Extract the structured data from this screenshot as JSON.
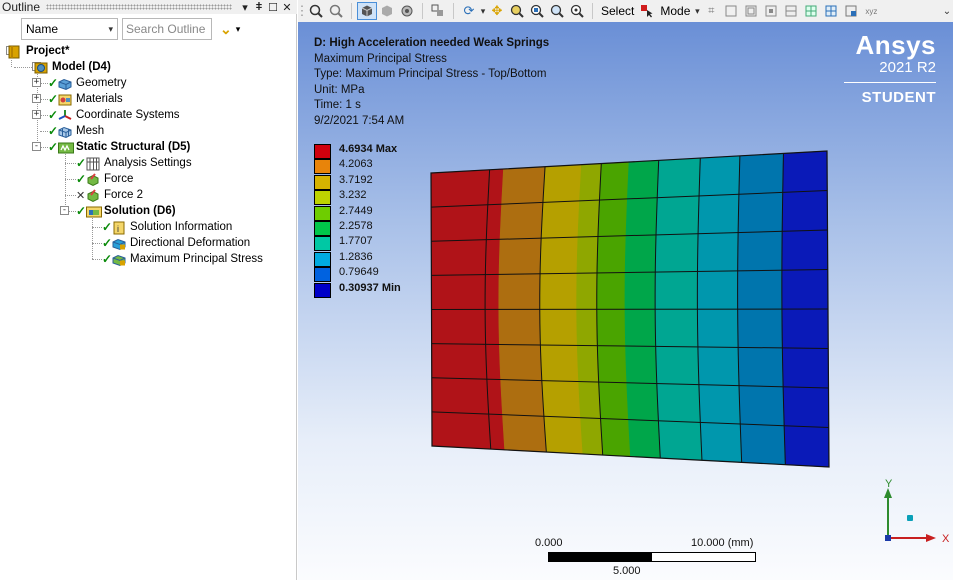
{
  "outline": {
    "title": "Outline",
    "pin": "⇤",
    "pin_icon": "▾",
    "pin2": "丨",
    "maximize": "□",
    "close": "✕",
    "name_select": "Name",
    "search_placeholder": "Search Outline"
  },
  "tree": [
    {
      "id": "project",
      "label": "Project*",
      "bold": true,
      "status": "none",
      "icon": "project-icon",
      "color": "#d8a200"
    },
    {
      "id": "model",
      "label": "Model (D4)",
      "bold": true,
      "status": "none",
      "icon": "model-icon",
      "color": "#4f8fc0"
    },
    {
      "id": "geometry",
      "label": "Geometry",
      "bold": false,
      "status": "check",
      "icon": "geometry-icon",
      "color": "#5aa0d8"
    },
    {
      "id": "materials",
      "label": "Materials",
      "bold": false,
      "status": "check",
      "icon": "materials-icon",
      "color": "#d8a200"
    },
    {
      "id": "coordinate-systems",
      "label": "Coordinate Systems",
      "bold": false,
      "status": "check",
      "icon": "coordinate-systems-icon",
      "color": "#d84040"
    },
    {
      "id": "mesh",
      "label": "Mesh",
      "bold": false,
      "status": "check",
      "icon": "mesh-icon",
      "color": "#5aa0d8"
    },
    {
      "id": "static-structural",
      "label": "Static Structural (D5)",
      "bold": true,
      "status": "check",
      "icon": "static-structural-icon",
      "color": "#74b944"
    },
    {
      "id": "analysis-settings",
      "label": "Analysis Settings",
      "bold": false,
      "status": "check",
      "icon": "analysis-settings-icon",
      "color": "#4f8fc0"
    },
    {
      "id": "force",
      "label": "Force",
      "bold": false,
      "status": "check",
      "icon": "force-icon",
      "color": "#d84040"
    },
    {
      "id": "force-2",
      "label": "Force 2",
      "bold": false,
      "status": "x",
      "icon": "force-icon",
      "color": "#d84040"
    },
    {
      "id": "solution",
      "label": "Solution (D6)",
      "bold": true,
      "status": "check",
      "icon": "solution-icon",
      "color": "#74b944"
    },
    {
      "id": "solution-information",
      "label": "Solution Information",
      "bold": false,
      "status": "check",
      "icon": "solution-information-icon",
      "color": "#d8a200"
    },
    {
      "id": "directional-deformation",
      "label": "Directional Deformation",
      "bold": false,
      "status": "check",
      "icon": "directional-deformation-icon",
      "color": "#74b944"
    },
    {
      "id": "maximum-principal-stress",
      "label": "Maximum Principal Stress",
      "bold": false,
      "status": "check",
      "icon": "result-icon",
      "color": "#d8a200",
      "selected": true
    }
  ],
  "toolbar": {
    "select_label": "Select",
    "mode_label": "Mode",
    "items": [
      "zoom-in-icon",
      "zoom-out-icon",
      "shaded-box-icon",
      "wireframe-box-icon",
      "view-icon",
      "select-icon",
      "rotate-icon",
      "pan-icon",
      "zoom-icon",
      "zoom-box-icon",
      "zoom-fit-icon",
      "zoom-all-icon"
    ]
  },
  "result": {
    "title": "D: High Acceleration needed Weak Springs",
    "subtitle": "Maximum Principal Stress",
    "type": "Type: Maximum Principal Stress - Top/Bottom",
    "unit": "Unit: MPa",
    "time": "Time: 1 s",
    "date": "9/2/2021 7:54 AM"
  },
  "brand": {
    "logo": "Ansys",
    "version": "2021 R2",
    "edition": "STUDENT"
  },
  "legend": {
    "labels": [
      "4.6934 Max",
      "4.2063",
      "3.7192",
      "3.232",
      "2.7449",
      "2.2578",
      "1.7707",
      "1.2836",
      "0.79649",
      "0.30937 Min"
    ],
    "colors": [
      "#d0000d",
      "#e8840a",
      "#d6b200",
      "#bed300",
      "#6ecd00",
      "#00c74a",
      "#00c8a4",
      "#00aae0",
      "#0062e0",
      "#0000c8"
    ]
  },
  "contour_colors": [
    "#b01318",
    "#ad6e10",
    "#b5a000",
    "#8fa700",
    "#4aa400",
    "#00a64a",
    "#00a692",
    "#0097ad",
    "#0075ad",
    "#0a1ab8"
  ],
  "scale": {
    "left": "0.000",
    "right": "10.000 (mm)",
    "mid": "5.000"
  },
  "triad": {
    "y": "Y",
    "x": "X"
  }
}
